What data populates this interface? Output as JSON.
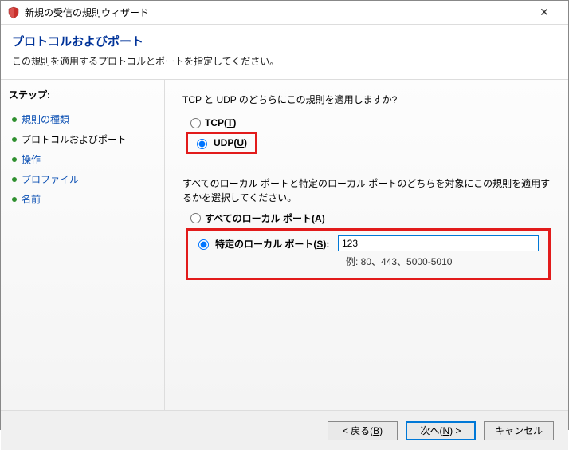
{
  "window": {
    "title": "新規の受信の規則ウィザード",
    "icon": "shield-icon",
    "close_label": "✕"
  },
  "header": {
    "title": "プロトコルおよびポート",
    "subtitle": "この規則を適用するプロトコルとポートを指定してください。"
  },
  "sidebar": {
    "steps_label": "ステップ:",
    "items": [
      {
        "label": "規則の種類"
      },
      {
        "label": "プロトコルおよびポート"
      },
      {
        "label": "操作"
      },
      {
        "label": "プロファイル"
      },
      {
        "label": "名前"
      }
    ]
  },
  "content": {
    "protocol_question": "TCP と UDP のどちらにこの規則を適用しますか?",
    "tcp_label": "TCP(T)",
    "udp_label": "UDP(U)",
    "port_scope_question": "すべてのローカル ポートと特定のローカル ポートのどちらを対象にこの規則を適用するかを選択してください。",
    "all_ports_label": "すべてのローカル ポート(A)",
    "specific_ports_label": "特定のローカル ポート(S):",
    "port_value": "123",
    "port_example": "例: 80、443、5000-5010"
  },
  "buttons": {
    "back": "< 戻る(B)",
    "next": "次へ(N) >",
    "cancel": "キャンセル"
  }
}
